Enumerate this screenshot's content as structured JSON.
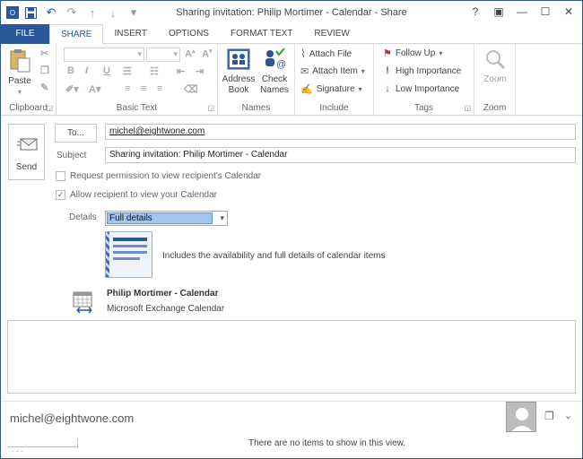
{
  "window": {
    "title": "Sharing invitation: Philip Mortimer - Calendar - Share",
    "help": "?",
    "ribbon_opts": "▣",
    "minimize": "—",
    "maximize": "☐",
    "close": "✕"
  },
  "qat": {
    "save": "💾",
    "undo": "↶",
    "redo": "↷",
    "up": "↑",
    "down": "↓",
    "more": "▾"
  },
  "tabs": [
    "FILE",
    "SHARE",
    "INSERT",
    "OPTIONS",
    "FORMAT TEXT",
    "REVIEW"
  ],
  "ribbon": {
    "clipboard": {
      "label": "Clipboard",
      "paste": "Paste"
    },
    "basic_text": {
      "label": "Basic Text",
      "bold": "B",
      "italic": "I",
      "underline": "U"
    },
    "names": {
      "label": "Names",
      "address_book_1": "Address",
      "address_book_2": "Book",
      "check_names_1": "Check",
      "check_names_2": "Names"
    },
    "include": {
      "label": "Include",
      "attach_file": "Attach File",
      "attach_item": "Attach Item",
      "signature": "Signature"
    },
    "tags": {
      "label": "Tags",
      "follow_up": "Follow Up",
      "high_importance": "High Importance",
      "low_importance": "Low Importance"
    },
    "zoom": {
      "label": "Zoom",
      "button": "Zoom"
    }
  },
  "form": {
    "send": "Send",
    "to_button": "To...",
    "to_value": "michel@eightwone.com",
    "subject_label": "Subject",
    "subject_value": "Sharing invitation: Philip Mortimer - Calendar",
    "request_permission": "Request permission to view recipient's Calendar",
    "request_permission_checked": false,
    "allow_view": "Allow recipient to view your Calendar",
    "allow_view_checked": true,
    "details_label": "Details",
    "details_value": "Full details",
    "details_description": "Includes the availability and full details of calendar items",
    "calendar_name": "Philip Mortimer - Calendar",
    "calendar_type": "Microsoft Exchange Calendar"
  },
  "people_pane": {
    "name": "michel@eightwone.com",
    "no_items": "There are no items to show in this view.",
    "dots": "· · ·"
  },
  "colors": {
    "accent": "#2b579a",
    "selection": "#9fc5f0",
    "flag": "#c0392b"
  }
}
